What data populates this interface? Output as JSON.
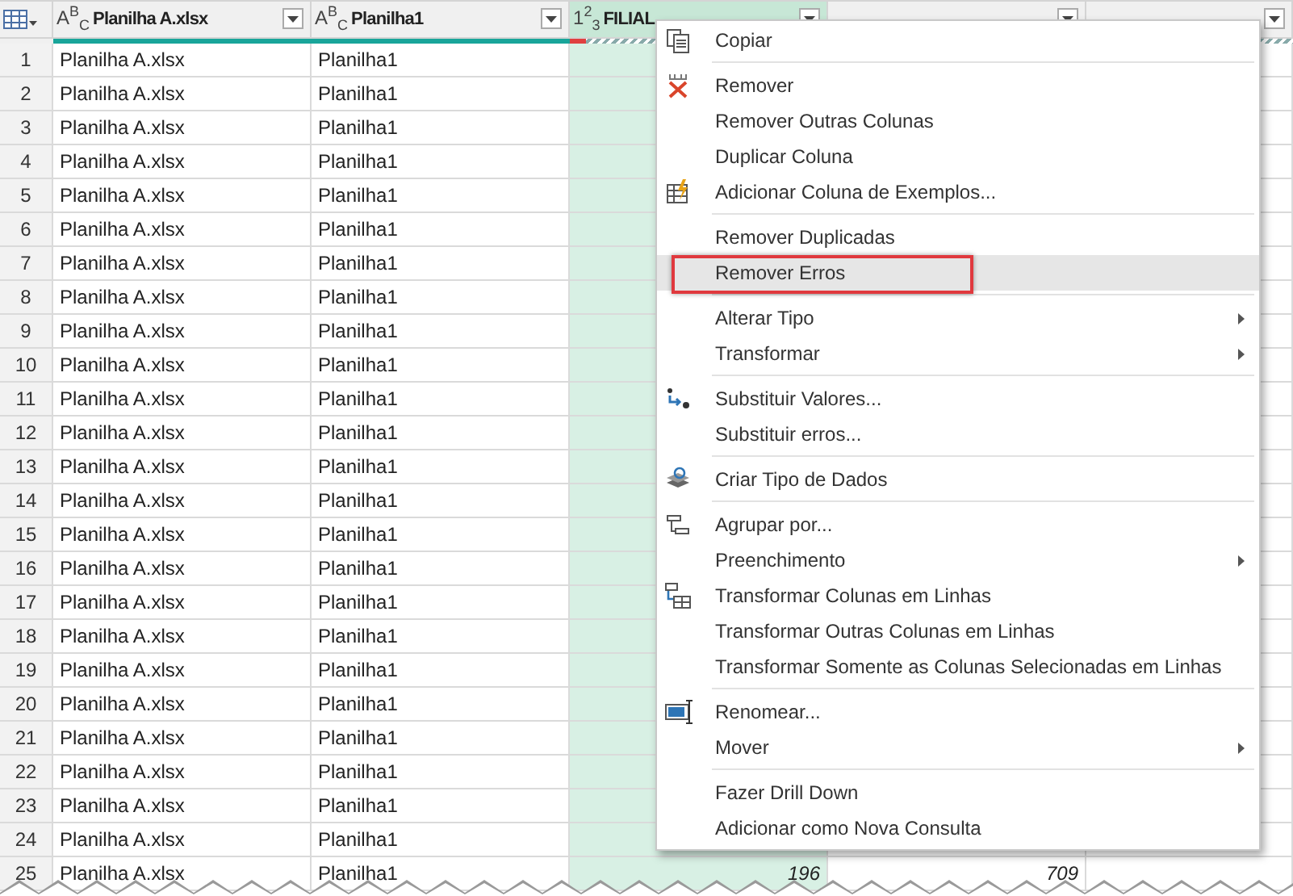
{
  "table": {
    "columns": [
      {
        "type": "A$^{B}$$_{C}$",
        "name": "Planilha A.xlsx",
        "selected": false,
        "has_errors": false
      },
      {
        "type": "A$^{B}$$_{C}$",
        "name": "Planilha1",
        "selected": false,
        "has_errors": false
      },
      {
        "type": "1$^{2}$$_{3}$",
        "name": "FILIAL",
        "selected": true,
        "has_errors": true
      },
      {
        "selected": false
      },
      {
        "selected": false,
        "has_errors": true
      }
    ],
    "rows": [
      {
        "number": "1",
        "cells": [
          "Planilha A.xlsx",
          "Planilha1"
        ]
      },
      {
        "number": "2",
        "cells": [
          "Planilha A.xlsx",
          "Planilha1"
        ]
      },
      {
        "number": "3",
        "cells": [
          "Planilha A.xlsx",
          "Planilha1"
        ]
      },
      {
        "number": "4",
        "cells": [
          "Planilha A.xlsx",
          "Planilha1"
        ]
      },
      {
        "number": "5",
        "cells": [
          "Planilha A.xlsx",
          "Planilha1"
        ]
      },
      {
        "number": "6",
        "cells": [
          "Planilha A.xlsx",
          "Planilha1"
        ]
      },
      {
        "number": "7",
        "cells": [
          "Planilha A.xlsx",
          "Planilha1"
        ]
      },
      {
        "number": "8",
        "cells": [
          "Planilha A.xlsx",
          "Planilha1"
        ]
      },
      {
        "number": "9",
        "cells": [
          "Planilha A.xlsx",
          "Planilha1"
        ]
      },
      {
        "number": "10",
        "cells": [
          "Planilha A.xlsx",
          "Planilha1"
        ]
      },
      {
        "number": "11",
        "cells": [
          "Planilha A.xlsx",
          "Planilha1"
        ]
      },
      {
        "number": "12",
        "cells": [
          "Planilha A.xlsx",
          "Planilha1"
        ]
      },
      {
        "number": "13",
        "cells": [
          "Planilha A.xlsx",
          "Planilha1"
        ]
      },
      {
        "number": "14",
        "cells": [
          "Planilha A.xlsx",
          "Planilha1"
        ]
      },
      {
        "number": "15",
        "cells": [
          "Planilha A.xlsx",
          "Planilha1"
        ]
      },
      {
        "number": "16",
        "cells": [
          "Planilha A.xlsx",
          "Planilha1"
        ]
      },
      {
        "number": "17",
        "cells": [
          "Planilha A.xlsx",
          "Planilha1"
        ]
      },
      {
        "number": "18",
        "cells": [
          "Planilha A.xlsx",
          "Planilha1"
        ]
      },
      {
        "number": "19",
        "cells": [
          "Planilha A.xlsx",
          "Planilha1"
        ]
      },
      {
        "number": "20",
        "cells": [
          "Planilha A.xlsx",
          "Planilha1"
        ]
      },
      {
        "number": "21",
        "cells": [
          "Planilha A.xlsx",
          "Planilha1"
        ]
      },
      {
        "number": "22",
        "cells": [
          "Planilha A.xlsx",
          "Planilha1"
        ]
      },
      {
        "number": "23",
        "cells": [
          "Planilha A.xlsx",
          "Planilha1"
        ]
      },
      {
        "number": "24",
        "cells": [
          "Planilha A.xlsx",
          "Planilha1"
        ]
      },
      {
        "number": "25",
        "cells": [
          "Planilha A.xlsx",
          "Planilha1",
          "196",
          "709"
        ]
      }
    ]
  },
  "context_menu": {
    "sections": [
      {
        "items": [
          {
            "label": "Copiar",
            "kind": "copy",
            "submenu": false,
            "selected": false,
            "outlined": false
          }
        ]
      },
      {
        "items": [
          {
            "label": "Remover",
            "kind": "remove",
            "submenu": false,
            "selected": false,
            "outlined": false
          },
          {
            "label": "Remover Outras Colunas",
            "submenu": false,
            "selected": false,
            "outlined": false
          },
          {
            "label": "Duplicar Coluna",
            "submenu": false,
            "selected": false,
            "outlined": false
          },
          {
            "label": "Adicionar Coluna de Exemplos...",
            "kind": "examples",
            "submenu": false,
            "selected": false,
            "outlined": false
          }
        ]
      },
      {
        "items": [
          {
            "label": "Remover Duplicadas",
            "submenu": false,
            "selected": false,
            "outlined": false
          },
          {
            "label": "Remover Erros",
            "submenu": false,
            "selected": true,
            "outlined": true
          }
        ]
      },
      {
        "items": [
          {
            "label": "Alterar Tipo",
            "submenu": true,
            "selected": false,
            "outlined": false
          },
          {
            "label": "Transformar",
            "submenu": true,
            "selected": false,
            "outlined": false
          }
        ]
      },
      {
        "items": [
          {
            "label": "Substituir Valores...",
            "kind": "replace",
            "submenu": false,
            "selected": false,
            "outlined": false
          },
          {
            "label": "Substituir erros...",
            "submenu": false,
            "selected": false,
            "outlined": false
          }
        ]
      },
      {
        "items": [
          {
            "label": "Criar Tipo de Dados",
            "kind": "datatype",
            "submenu": false,
            "selected": false,
            "outlined": false
          }
        ]
      },
      {
        "items": [
          {
            "label": "Agrupar por...",
            "kind": "group",
            "submenu": false,
            "selected": false,
            "outlined": false
          },
          {
            "label": "Preenchimento",
            "submenu": true,
            "selected": false,
            "outlined": false
          },
          {
            "label": "Transformar Colunas em Linhas",
            "kind": "unpivot",
            "submenu": false,
            "selected": false,
            "outlined": false
          },
          {
            "label": "Transformar Outras Colunas em Linhas",
            "submenu": false,
            "selected": false,
            "outlined": false
          },
          {
            "label": "Transformar Somente as Colunas Selecionadas em Linhas",
            "submenu": false,
            "selected": false,
            "outlined": false
          }
        ]
      },
      {
        "items": [
          {
            "label": "Renomear...",
            "kind": "rename",
            "submenu": false,
            "selected": false,
            "outlined": false
          },
          {
            "label": "Mover",
            "submenu": true,
            "selected": false,
            "outlined": false
          }
        ]
      },
      {
        "items": [
          {
            "label": "Fazer Drill Down",
            "submenu": false,
            "selected": false,
            "outlined": false
          },
          {
            "label": "Adicionar como Nova Consulta",
            "submenu": false,
            "selected": false,
            "outlined": false
          }
        ]
      }
    ]
  }
}
